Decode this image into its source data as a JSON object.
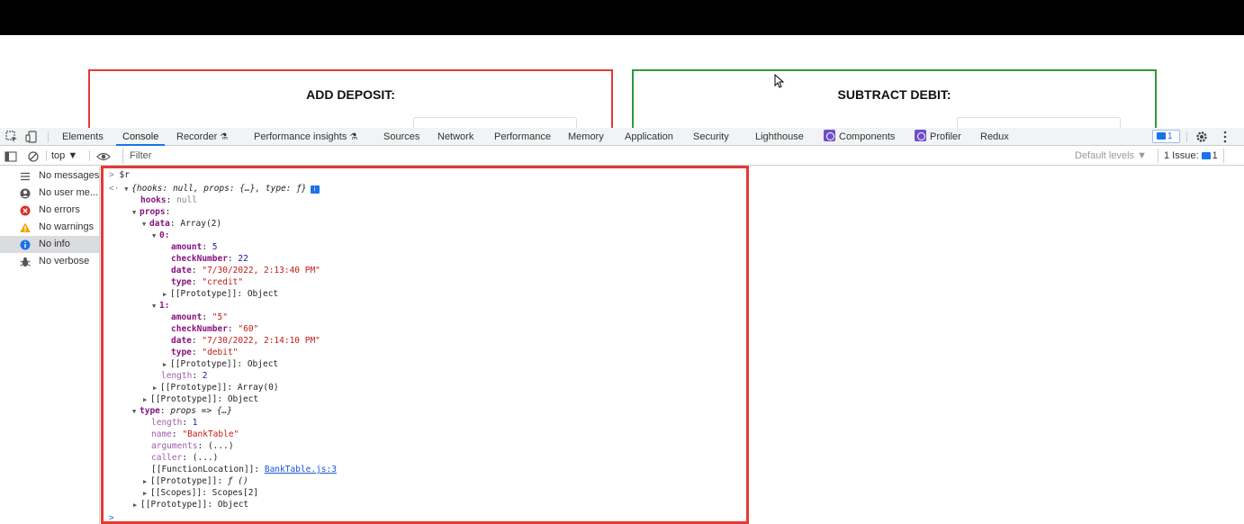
{
  "page": {
    "deposit_title": "ADD DEPOSIT:",
    "debit_title": "SUBTRACT DEBIT:"
  },
  "devtools": {
    "tabs": [
      {
        "label": "Elements"
      },
      {
        "label": "Console"
      },
      {
        "label": "Recorder"
      },
      {
        "label": "Performance insights"
      },
      {
        "label": "Sources"
      },
      {
        "label": "Network"
      },
      {
        "label": "Performance"
      },
      {
        "label": "Memory"
      },
      {
        "label": "Application"
      },
      {
        "label": "Security"
      },
      {
        "label": "Lighthouse"
      },
      {
        "label": "Components"
      },
      {
        "label": "Profiler"
      },
      {
        "label": "Redux"
      }
    ],
    "active_tab": "Console",
    "messages_badge": "1",
    "context": "top ▼",
    "filter_placeholder": "Filter",
    "levels": "Default levels ▼",
    "issues": "1 Issue:",
    "issues_count": "1",
    "colors": {
      "accent": "#1a73e8",
      "highlight": "#e53935",
      "debit_border": "#2e9a3a"
    }
  },
  "sidebar": {
    "items": [
      {
        "label": "No messages",
        "icon": "list-icon"
      },
      {
        "label": "No user me...",
        "icon": "user-icon"
      },
      {
        "label": "No errors",
        "icon": "error-icon"
      },
      {
        "label": "No warnings",
        "icon": "warning-icon"
      },
      {
        "label": "No info",
        "icon": "info-icon"
      },
      {
        "label": "No verbose",
        "icon": "bug-icon"
      }
    ]
  },
  "console": {
    "input_command": "$r",
    "summary": "{hooks: null, props: {…}, type: ƒ}",
    "summary_badge": "i",
    "hooks_key": "hooks",
    "hooks_value": "null",
    "props_key": "props",
    "data_key": "data",
    "data_value": "Array(2)",
    "items": [
      {
        "index": "0",
        "amount": "5",
        "checkNumber": "22",
        "date": "\"7/30/2022, 2:13:40 PM\"",
        "type": "\"credit\"",
        "prototype": "Object"
      },
      {
        "index": "1",
        "amount": "\"5\"",
        "checkNumber": "\"60\"",
        "date": "\"7/30/2022, 2:14:10 PM\"",
        "type": "\"debit\"",
        "prototype": "Object"
      }
    ],
    "length_key": "length",
    "length_value": "2",
    "array_proto_value": "Array(0)",
    "props_proto_value": "Object",
    "type_key": "type",
    "type_value": "props => {…}",
    "fn_length_value": "1",
    "fn_name_value": "\"BankTable\"",
    "fn_arguments_value": "(...)",
    "fn_caller_value": "(...)",
    "fn_location_key": "[[FunctionLocation]]",
    "fn_location_value": "BankTable.js:3",
    "fn_proto_value": "ƒ ()",
    "fn_scopes_key": "[[Scopes]]",
    "fn_scopes_value": "Scopes[2]",
    "root_proto_value": "Object",
    "prototype_key": "[[Prototype]]"
  }
}
